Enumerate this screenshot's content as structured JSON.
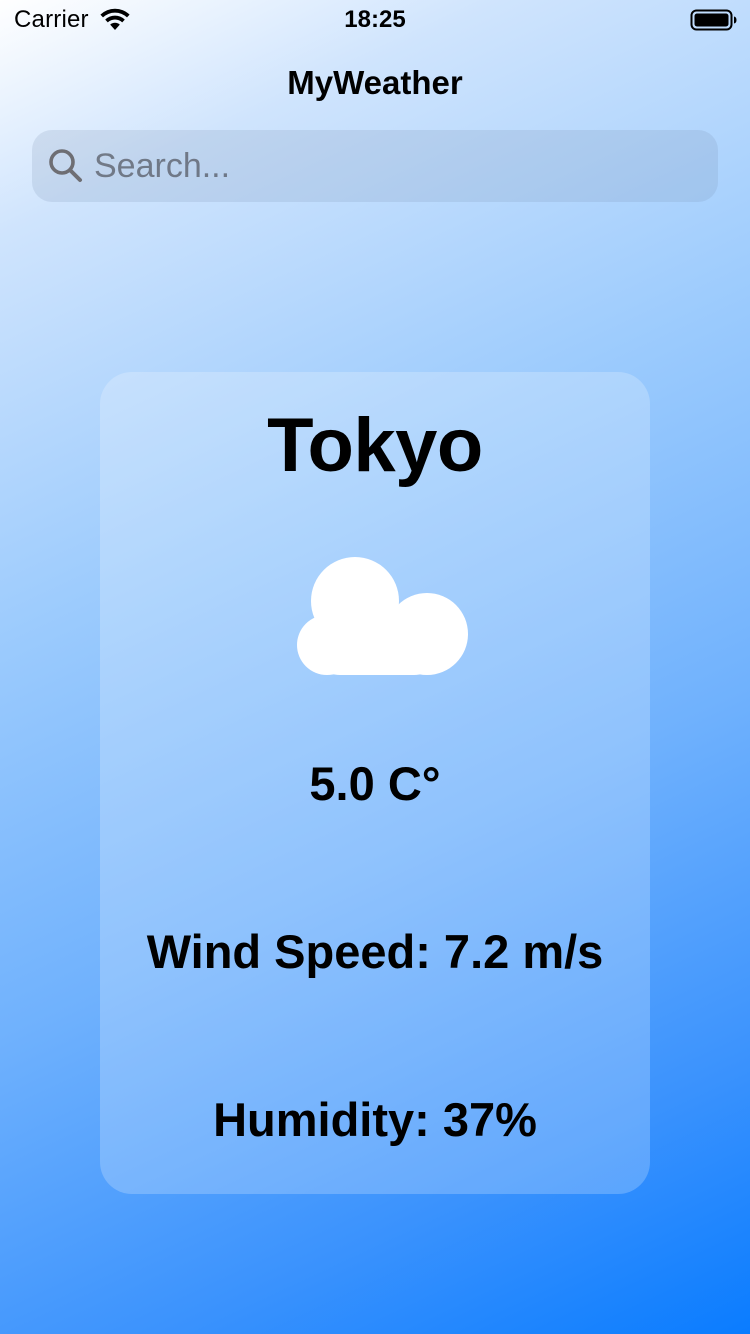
{
  "status_bar": {
    "carrier": "Carrier",
    "time": "18:25",
    "wifi_icon": "wifi-icon",
    "battery_icon": "battery-full-icon"
  },
  "app": {
    "title": "MyWeather"
  },
  "search": {
    "placeholder": "Search...",
    "value": "",
    "icon": "magnifying-glass-icon"
  },
  "weather": {
    "city": "Tokyo",
    "condition_icon": "cloud-icon",
    "temperature": "5.0 C°",
    "wind_speed": "Wind Speed: 7.2 m/s",
    "humidity": "Humidity: 37%"
  },
  "colors": {
    "gradient_start": "#ffffff",
    "gradient_end": "#0a7cff",
    "card_fill": "rgba(255,255,255,0.22)",
    "text": "#000000",
    "cloud": "#ffffff"
  }
}
